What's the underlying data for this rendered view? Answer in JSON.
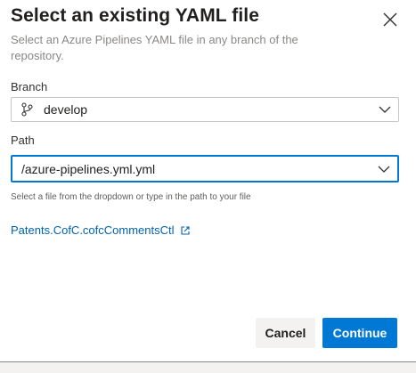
{
  "dialog": {
    "title": "Select an existing YAML file",
    "subtitle": "Select an Azure Pipelines YAML file in any branch of the repository.",
    "close_icon": "close-icon"
  },
  "branch": {
    "label": "Branch",
    "value": "develop",
    "icon": "git-branch-icon"
  },
  "path": {
    "label": "Path",
    "value": "/azure-pipelines.yml.yml",
    "helper": "Select a file from the dropdown or type in the path to your file"
  },
  "repo_link": {
    "text": "Patents.CofC.cofcCommentsCtl",
    "icon": "external-link-icon"
  },
  "buttons": {
    "cancel": "Cancel",
    "continue": "Continue"
  },
  "colors": {
    "accent": "#0078d4",
    "link": "#0062ad",
    "secondary_button": "#f3f2f1"
  }
}
